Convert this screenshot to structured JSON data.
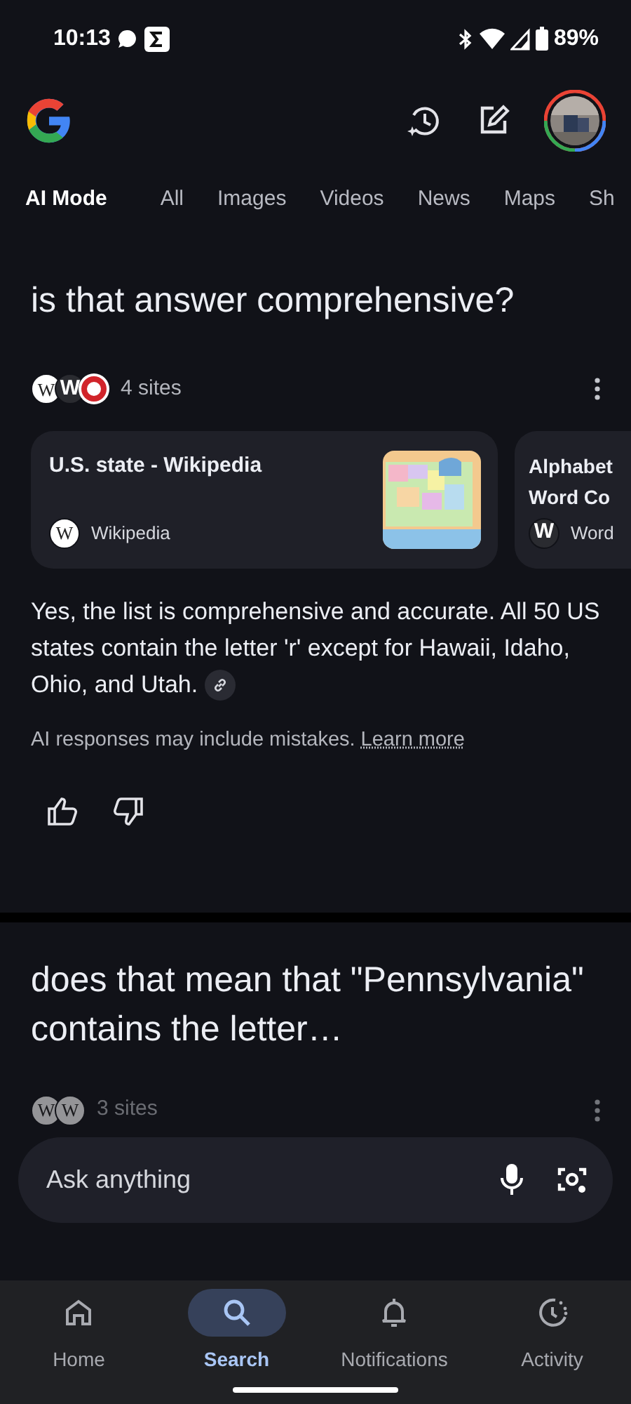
{
  "status_bar": {
    "time": "10:13",
    "battery": "89%"
  },
  "tabs": [
    {
      "label": "AI Mode",
      "selected": true
    },
    {
      "label": "All",
      "selected": false
    },
    {
      "label": "Images",
      "selected": false
    },
    {
      "label": "Videos",
      "selected": false
    },
    {
      "label": "News",
      "selected": false
    },
    {
      "label": "Maps",
      "selected": false
    },
    {
      "label": "Sh",
      "selected": false
    }
  ],
  "turns": [
    {
      "question": "is that answer comprehensive?",
      "sources": {
        "count": "4 sites",
        "favicons": [
          {
            "kind": "wiki",
            "letter": "W"
          },
          {
            "kind": "word",
            "letter": "W"
          },
          {
            "kind": "ring"
          }
        ],
        "cards": [
          {
            "title": "U.S. state - Wikipedia",
            "site": "Wikipedia",
            "favicon": {
              "kind": "wiki",
              "letter": "W"
            }
          },
          {
            "title": "Alphabet Word Co",
            "site": "Word",
            "favicon": {
              "kind": "word",
              "letter": "W"
            }
          }
        ]
      },
      "answer": "Yes, the list is comprehensive and accurate. All 50 US states contain the letter 'r' except for Hawaii, Idaho, Ohio, and Utah.",
      "disclaimer": "AI responses may include mistakes.",
      "learn_more": "Learn more",
      "faded": false
    },
    {
      "question": "does that mean that \"Pennsylvania\" contains the letter…",
      "sources": {
        "count": "3 sites",
        "favicons": [
          {
            "kind": "wiki",
            "letter": "W"
          },
          {
            "kind": "wiki",
            "letter": "W"
          }
        ]
      },
      "faded": true
    }
  ],
  "search": {
    "placeholder": "Ask anything"
  },
  "nav": [
    {
      "label": "Home",
      "kind": "home",
      "selected": false
    },
    {
      "label": "Search",
      "kind": "search",
      "selected": true
    },
    {
      "label": "Notifications",
      "kind": "bell",
      "selected": false
    },
    {
      "label": "Activity",
      "kind": "activity",
      "selected": false
    }
  ]
}
